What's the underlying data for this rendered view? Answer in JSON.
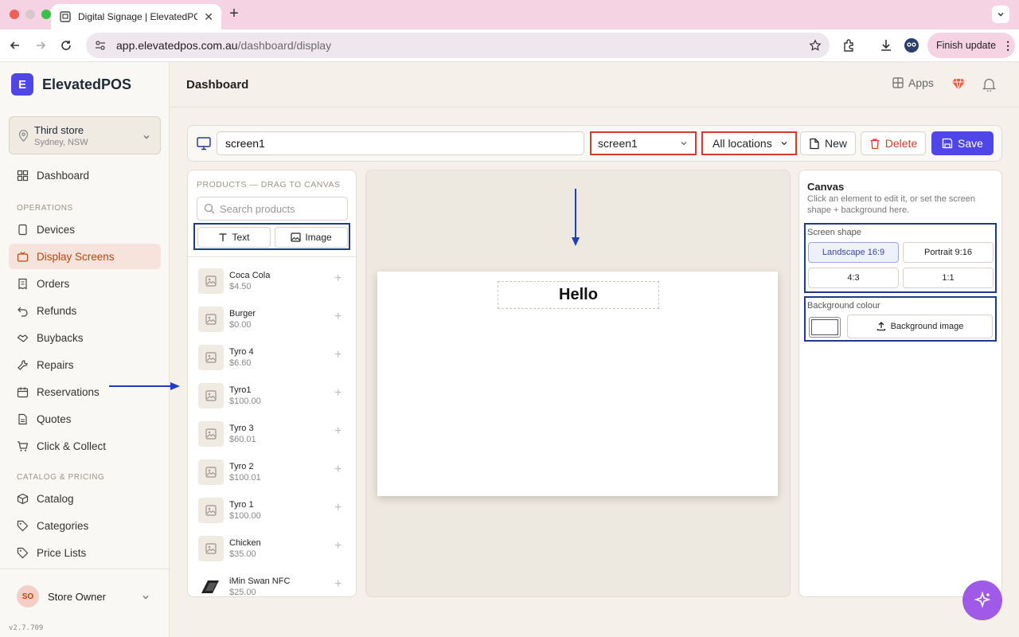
{
  "browser": {
    "tab_title": "Digital Signage | ElevatedPOS",
    "url_host": "app.elevatedpos.com.au",
    "url_path": "/dashboard/display",
    "finish_update": "Finish update"
  },
  "sidebar": {
    "logo_letter": "E",
    "brand": "ElevatedPOS",
    "store_name": "Third store",
    "store_location": "Sydney, NSW",
    "top_item": "Dashboard",
    "operations_label": "OPERATIONS",
    "operations": [
      "Devices",
      "Display Screens",
      "Orders",
      "Refunds",
      "Buybacks",
      "Repairs",
      "Reservations",
      "Quotes",
      "Click & Collect"
    ],
    "catalog_label": "CATALOG & PRICING",
    "catalog": [
      "Catalog",
      "Categories",
      "Price Lists"
    ],
    "user_initials": "SO",
    "user_name": "Store Owner",
    "version": "v2.7.709"
  },
  "header": {
    "title": "Dashboard",
    "apps_label": "Apps"
  },
  "editor": {
    "screen_name": "screen1",
    "screen_select": "screen1",
    "location_select": "All locations",
    "new_label": "New",
    "delete_label": "Delete",
    "save_label": "Save"
  },
  "products": {
    "header": "PRODUCTS — DRAG TO CANVAS",
    "search_placeholder": "Search products",
    "text_tool": "Text",
    "image_tool": "Image",
    "items": [
      {
        "name": "Coca Cola",
        "price": "$4.50"
      },
      {
        "name": "Burger",
        "price": "$0.00"
      },
      {
        "name": "Tyro 4",
        "price": "$6.60"
      },
      {
        "name": "Tyro1",
        "price": "$100.00"
      },
      {
        "name": "Tyro 3",
        "price": "$60.01"
      },
      {
        "name": "Tyro 2",
        "price": "$100.01"
      },
      {
        "name": "Tyro 1",
        "price": "$100.00"
      },
      {
        "name": "Chicken",
        "price": "$35.00"
      },
      {
        "name": "iMin Swan NFC",
        "price": "$25.00"
      }
    ]
  },
  "canvas": {
    "hello_text": "Hello"
  },
  "props": {
    "title": "Canvas",
    "description": "Click an element to edit it, or set the screen shape + background here.",
    "screen_shape_label": "Screen shape",
    "shapes": [
      "Landscape 16:9",
      "Portrait 9:16",
      "4:3",
      "1:1"
    ],
    "bg_colour_label": "Background colour",
    "bg_colour": "#ffffff",
    "bg_image_label": "Background image"
  },
  "colors": {
    "accent": "#4f46e5",
    "delete": "#d33b2a",
    "active_nav": "#c2410c",
    "annotation_red": "#d33b2a",
    "annotation_blue": "#1e3a8a"
  }
}
